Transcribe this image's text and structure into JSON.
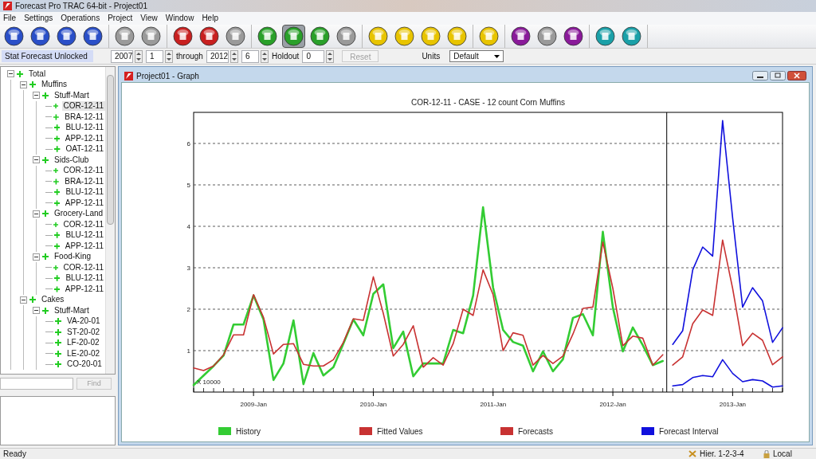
{
  "window": {
    "title": "Forecast Pro TRAC 64-bit - Project01"
  },
  "menu": [
    "File",
    "Settings",
    "Operations",
    "Project",
    "View",
    "Window",
    "Help"
  ],
  "toolbar": [
    {
      "buttons": [
        {
          "color": "#2a4fc8",
          "selected": false
        },
        {
          "color": "#2a4fc8",
          "selected": false
        },
        {
          "color": "#2a4fc8",
          "selected": false
        },
        {
          "color": "#2a4fc8",
          "selected": false
        }
      ]
    },
    {
      "buttons": [
        {
          "color": "#9a9a9a",
          "selected": false
        },
        {
          "color": "#9a9a9a",
          "selected": false
        }
      ]
    },
    {
      "buttons": [
        {
          "color": "#c82020",
          "selected": false
        },
        {
          "color": "#c82020",
          "selected": false
        },
        {
          "color": "#9a9a9a",
          "selected": false
        }
      ]
    },
    {
      "buttons": [
        {
          "color": "#2aa02a",
          "selected": false
        },
        {
          "color": "#2aa02a",
          "selected": true
        },
        {
          "color": "#2aa02a",
          "selected": false
        },
        {
          "color": "#9a9a9a",
          "selected": false
        }
      ]
    },
    {
      "buttons": [
        {
          "color": "#e8c400",
          "selected": false
        },
        {
          "color": "#e8c400",
          "selected": false
        },
        {
          "color": "#e8c400",
          "selected": false
        },
        {
          "color": "#e8c400",
          "selected": false
        }
      ]
    },
    {
      "buttons": [
        {
          "color": "#e8c400",
          "selected": false
        }
      ]
    },
    {
      "buttons": [
        {
          "color": "#8a1a9a",
          "selected": false
        },
        {
          "color": "#9a9a9a",
          "selected": false
        },
        {
          "color": "#8a1a9a",
          "selected": false
        }
      ]
    },
    {
      "buttons": [
        {
          "color": "#1aa0a8",
          "selected": false
        },
        {
          "color": "#1aa0a8",
          "selected": false
        }
      ]
    }
  ],
  "params": {
    "status": "Stat Forecast Unlocked",
    "start_year": "2007",
    "start_period": "1",
    "through_label": "through",
    "end_year": "2012",
    "end_period": "6",
    "holdout_label": "Holdout",
    "holdout": "0",
    "reset": {
      "label": "Reset",
      "disabled": true
    },
    "units_label": "Units",
    "units": "Default"
  },
  "tree": [
    {
      "label": "Total",
      "expanded": true,
      "selected": false,
      "children": [
        {
          "label": "Muffins",
          "expanded": true,
          "selected": false,
          "children": [
            {
              "label": "Stuff-Mart",
              "expanded": true,
              "selected": false,
              "children": [
                {
                  "label": "COR-12-11",
                  "selected": true
                },
                {
                  "label": "BRA-12-11",
                  "selected": false
                },
                {
                  "label": "BLU-12-11",
                  "selected": false
                },
                {
                  "label": "APP-12-11",
                  "selected": false
                },
                {
                  "label": "OAT-12-11",
                  "selected": false
                }
              ]
            },
            {
              "label": "Sids-Club",
              "expanded": true,
              "selected": false,
              "children": [
                {
                  "label": "COR-12-11",
                  "selected": false
                },
                {
                  "label": "BRA-12-11",
                  "selected": false
                },
                {
                  "label": "BLU-12-11",
                  "selected": false
                },
                {
                  "label": "APP-12-11",
                  "selected": false
                }
              ]
            },
            {
              "label": "Grocery-Land",
              "expanded": true,
              "selected": false,
              "children": [
                {
                  "label": "COR-12-11",
                  "selected": false
                },
                {
                  "label": "BLU-12-11",
                  "selected": false
                },
                {
                  "label": "APP-12-11",
                  "selected": false
                }
              ]
            },
            {
              "label": "Food-King",
              "expanded": true,
              "selected": false,
              "children": [
                {
                  "label": "COR-12-11",
                  "selected": false
                },
                {
                  "label": "BLU-12-11",
                  "selected": false
                },
                {
                  "label": "APP-12-11",
                  "selected": false
                }
              ]
            }
          ]
        },
        {
          "label": "Cakes",
          "expanded": true,
          "selected": false,
          "children": [
            {
              "label": "Stuff-Mart",
              "expanded": true,
              "selected": false,
              "children": [
                {
                  "label": "VA-20-01",
                  "selected": false
                },
                {
                  "label": "ST-20-02",
                  "selected": false
                },
                {
                  "label": "LF-20-02",
                  "selected": false
                },
                {
                  "label": "LE-20-02",
                  "selected": false
                },
                {
                  "label": "CO-20-01",
                  "selected": false
                }
              ]
            }
          ]
        }
      ]
    }
  ],
  "find": {
    "label": "Find",
    "disabled": true
  },
  "graph_window": {
    "title": "Project01 - Graph",
    "chart_data": {
      "type": "line",
      "title": "COR-12-11 - CASE - 12 count Corn Muffins",
      "categories": [
        null,
        null,
        null,
        null,
        null,
        null,
        "2009-Jan",
        null,
        null,
        null,
        null,
        null,
        null,
        null,
        null,
        null,
        null,
        null,
        "2010-Jan",
        null,
        null,
        null,
        null,
        null,
        null,
        null,
        null,
        null,
        null,
        null,
        "2011-Jan",
        null,
        null,
        null,
        null,
        null,
        null,
        null,
        null,
        null,
        null,
        null,
        "2012-Jan",
        null,
        null,
        null,
        null,
        null,
        null,
        null,
        null,
        null,
        null,
        null,
        "2013-Jan",
        null,
        null,
        null,
        null,
        null
      ],
      "ylim": [
        0,
        6.75
      ],
      "yticks": [
        {
          "value": 1,
          "label": "1"
        },
        {
          "value": 2,
          "label": "2"
        },
        {
          "value": 3,
          "label": "3"
        },
        {
          "value": 4,
          "label": "4"
        },
        {
          "value": 5,
          "label": "5"
        },
        {
          "value": 6,
          "label": "6"
        }
      ],
      "grid": true,
      "legend": "bottom",
      "annotations": [
        "X 10000"
      ],
      "series": [
        {
          "name": "History",
          "color": "#33cc33",
          "values": [
            0.17,
            0.4,
            0.63,
            0.88,
            1.63,
            1.63,
            2.33,
            1.75,
            0.29,
            0.69,
            1.73,
            0.19,
            0.94,
            0.4,
            0.6,
            1.17,
            1.75,
            1.37,
            2.37,
            2.6,
            1.06,
            1.46,
            0.38,
            0.69,
            0.69,
            0.69,
            1.5,
            1.42,
            2.33,
            4.46,
            2.52,
            1.5,
            1.21,
            1.12,
            0.5,
            0.98,
            0.5,
            0.79,
            1.79,
            1.88,
            1.37,
            3.87,
            2.04,
            0.98,
            1.56,
            1.13,
            0.65,
            0.75,
            null,
            null,
            null,
            null,
            null,
            null,
            null,
            null,
            null,
            null,
            null,
            null
          ]
        },
        {
          "name": "Fitted Values",
          "color": "#c83232",
          "values": [
            0.58,
            0.52,
            0.63,
            0.9,
            1.38,
            1.38,
            2.35,
            1.8,
            0.92,
            1.15,
            1.17,
            0.67,
            0.63,
            0.63,
            0.78,
            1.2,
            1.77,
            1.73,
            2.78,
            1.9,
            0.87,
            1.15,
            1.6,
            0.6,
            0.83,
            0.65,
            1.17,
            2.0,
            1.85,
            2.95,
            2.35,
            1.0,
            1.43,
            1.37,
            0.65,
            0.88,
            0.69,
            0.87,
            1.4,
            2.02,
            2.05,
            3.62,
            2.5,
            1.12,
            1.35,
            1.3,
            0.65,
            0.9,
            null,
            null,
            null,
            null,
            null,
            null,
            null,
            null,
            null,
            null,
            null,
            null
          ]
        },
        {
          "name": "Forecasts",
          "color": "#c83232",
          "values": [
            null,
            null,
            null,
            null,
            null,
            null,
            null,
            null,
            null,
            null,
            null,
            null,
            null,
            null,
            null,
            null,
            null,
            null,
            null,
            null,
            null,
            null,
            null,
            null,
            null,
            null,
            null,
            null,
            null,
            null,
            null,
            null,
            null,
            null,
            null,
            null,
            null,
            null,
            null,
            null,
            null,
            null,
            null,
            null,
            null,
            null,
            null,
            null,
            0.65,
            0.85,
            1.65,
            1.98,
            1.85,
            3.67,
            2.5,
            1.12,
            1.42,
            1.25,
            0.66,
            0.85
          ]
        },
        {
          "name": "Forecast Interval",
          "color": "#1010dd",
          "values": [
            null,
            null,
            null,
            null,
            null,
            null,
            null,
            null,
            null,
            null,
            null,
            null,
            null,
            null,
            null,
            null,
            null,
            null,
            null,
            null,
            null,
            null,
            null,
            null,
            null,
            null,
            null,
            null,
            null,
            null,
            null,
            null,
            null,
            null,
            null,
            null,
            null,
            null,
            null,
            null,
            null,
            null,
            null,
            null,
            null,
            null,
            null,
            null,
            1.15,
            1.48,
            2.95,
            3.5,
            3.28,
            6.55,
            4.2,
            2.05,
            2.52,
            2.2,
            1.2,
            1.55
          ]
        },
        {
          "color": "#1010dd",
          "values": [
            null,
            null,
            null,
            null,
            null,
            null,
            null,
            null,
            null,
            null,
            null,
            null,
            null,
            null,
            null,
            null,
            null,
            null,
            null,
            null,
            null,
            null,
            null,
            null,
            null,
            null,
            null,
            null,
            null,
            null,
            null,
            null,
            null,
            null,
            null,
            null,
            null,
            null,
            null,
            null,
            null,
            null,
            null,
            null,
            null,
            null,
            null,
            null,
            0.15,
            0.18,
            0.35,
            0.4,
            0.37,
            0.78,
            0.45,
            0.25,
            0.3,
            0.27,
            0.12,
            0.15
          ]
        }
      ]
    }
  },
  "status_bar": {
    "message": "Ready",
    "hierarchy": "Hier. 1-2-3-4",
    "mode": "Local"
  }
}
